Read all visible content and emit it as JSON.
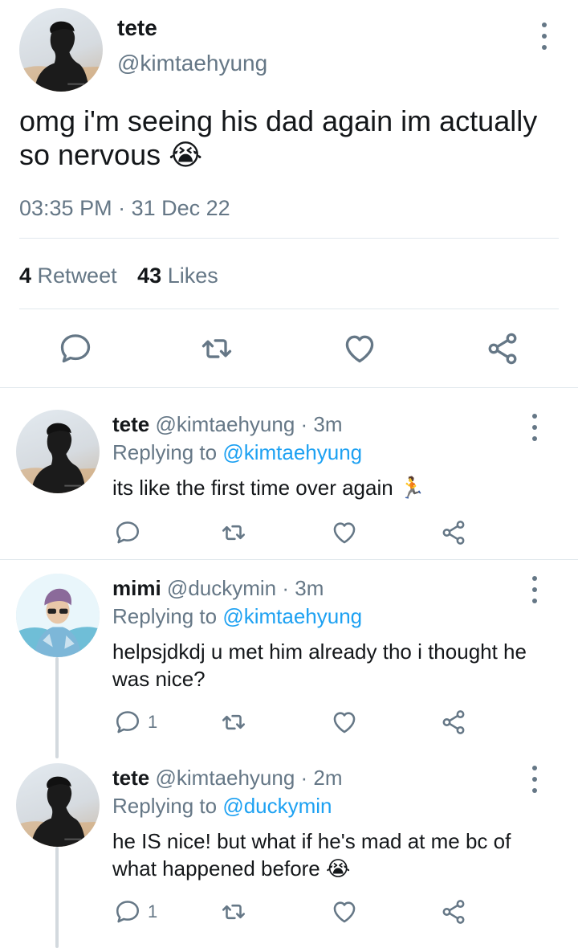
{
  "main_tweet": {
    "display_name": "tete",
    "handle": "@kimtaehyung",
    "text": "omg i'm seeing his dad again im actually so nervous",
    "emoji": "😭",
    "time": "03:35 PM",
    "sep": "·",
    "date": "31 Dec 22",
    "retweet_count": "4",
    "retweet_label": "Retweet",
    "like_count": "43",
    "like_label": "Likes"
  },
  "replies": [
    {
      "display_name": "tete",
      "handle": "@kimtaehyung",
      "time": "· 3m",
      "replying_prefix": "Replying to",
      "replying_to": "@kimtaehyung",
      "text": "its like the first time over again",
      "emoji": "🏃",
      "reply_count": ""
    },
    {
      "display_name": "mimi",
      "handle": "@duckymin",
      "time": "· 3m",
      "replying_prefix": "Replying to",
      "replying_to": "@kimtaehyung",
      "text": "helpsjdkdj u met him already tho i thought he was nice?",
      "reply_count": "1"
    },
    {
      "display_name": "tete",
      "handle": "@kimtaehyung",
      "time": "· 2m",
      "replying_prefix": "Replying to",
      "replying_to": "@duckymin",
      "text": "he IS nice! but what if he's mad at me bc of what happened before",
      "emoji": "😭",
      "reply_count": "1"
    }
  ],
  "icons": {
    "reply": "reply-icon",
    "retweet": "retweet-icon",
    "like": "heart-icon",
    "share": "share-icon",
    "more": "more-vertical-icon"
  },
  "colors": {
    "text": "#14171a",
    "muted": "#657786",
    "accent": "#1da1f2",
    "divider": "#e1e8ed"
  }
}
